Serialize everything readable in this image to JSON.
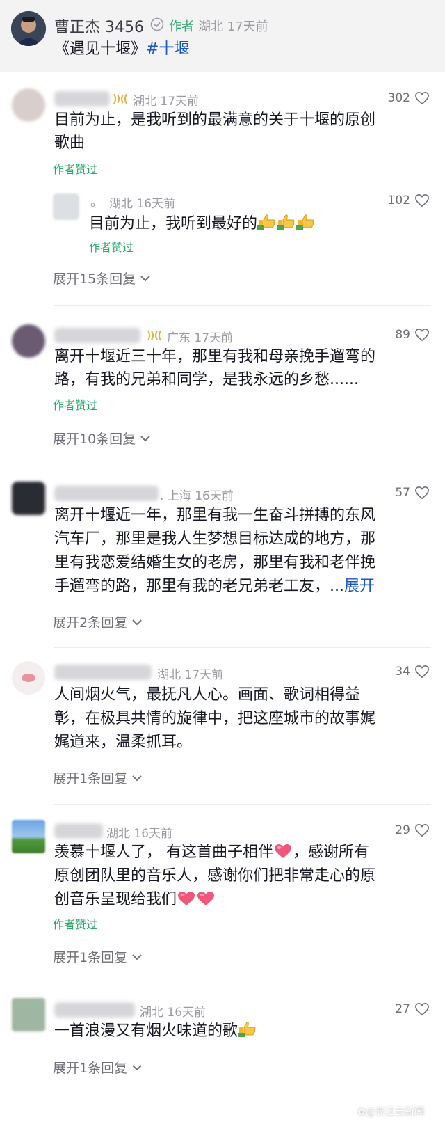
{
  "post": {
    "author_name": "曹正杰 3456",
    "author_tag": "作者",
    "region_time": "湖北 17天前",
    "title": "《遇见十堰》",
    "hashtag": "#十堰"
  },
  "comments": [
    {
      "region_time": "湖北 17天前",
      "likes": "302",
      "lines": [
        "目前为止，是我听到的最满意的关于十堰的原创",
        "歌曲"
      ],
      "author_liked": "作者赞过",
      "reply": {
        "name": "。",
        "region_time": "湖北 16天前",
        "likes": "102",
        "text": "目前为止，我听到最好的",
        "author_liked": "作者赞过"
      },
      "expand": "展开15条回复"
    },
    {
      "region_time": "广东 17天前",
      "likes": "89",
      "lines": [
        "离开十堰近三十年，那里有我和母亲挽手遛弯的",
        "路，有我的兄弟和同学，是我永远的乡愁......"
      ],
      "author_liked": "作者赞过",
      "expand": "展开10条回复"
    },
    {
      "region_time": ". 上海 16天前",
      "likes": "57",
      "lines": [
        "离开十堰近一年，那里有我一生奋斗拼搏的东风",
        "汽车厂，那里是我人生梦想目标达成的地方，那",
        "里有我恋爱结婚生女的老房，那里有我和老伴挽",
        "手遛弯的路，那里有我的老兄弟老工友，..."
      ],
      "expand_link": "展开",
      "expand": "展开2条回复"
    },
    {
      "region_time": "湖北 17天前",
      "likes": "34",
      "lines": [
        "人间烟火气，最抚凡人心。画面、歌词相得益",
        "彰，在极具共情的旋律中，把这座城市的故事娓",
        "娓道来，温柔抓耳。"
      ],
      "expand": "展开1条回复"
    },
    {
      "region_time": "湖北 16天前",
      "likes": "29",
      "lines": [
        "羡慕十堰人了， 有这首曲子相伴",
        "原创团队里的音乐人，感谢你们把非常走心的原",
        "创音乐呈现给我们"
      ],
      "line1_tail": "，感谢所有",
      "author_liked": "作者赞过",
      "expand": "展开1条回复"
    },
    {
      "region_time": "湖北 16天前",
      "likes": "27",
      "lines": [
        "一首浪漫又有烟火味道的歌"
      ],
      "expand": "展开1条回复"
    }
  ],
  "watermark": "长江云新闻",
  "colors": {
    "liked_green": "#2aa76a",
    "link_blue": "#1a56c4",
    "tag_green": "#2aa76a",
    "header_bg": "#f3f3f4"
  },
  "icons": [
    "verified-icon",
    "heart-outline-icon",
    "chevron-down-icon",
    "vip-badge-icon",
    "thumbs-up-emoji",
    "heart-emoji"
  ]
}
